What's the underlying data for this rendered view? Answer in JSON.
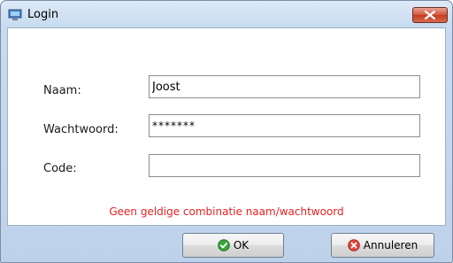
{
  "window": {
    "title": "Login"
  },
  "form": {
    "name_label": "Naam:",
    "name_value": "Joost",
    "password_label": "Wachtwoord:",
    "password_value": "*******",
    "code_label": "Code:",
    "code_value": ""
  },
  "error_message": "Geen geldige combinatie naam/wachtwoord",
  "buttons": {
    "ok": "OK",
    "cancel": "Annuleren"
  },
  "icons": {
    "window": "computer-icon",
    "close": "close-icon",
    "ok": "check-icon",
    "cancel": "cancel-icon"
  },
  "colors": {
    "error": "#e52222",
    "close": "#c33b21"
  }
}
